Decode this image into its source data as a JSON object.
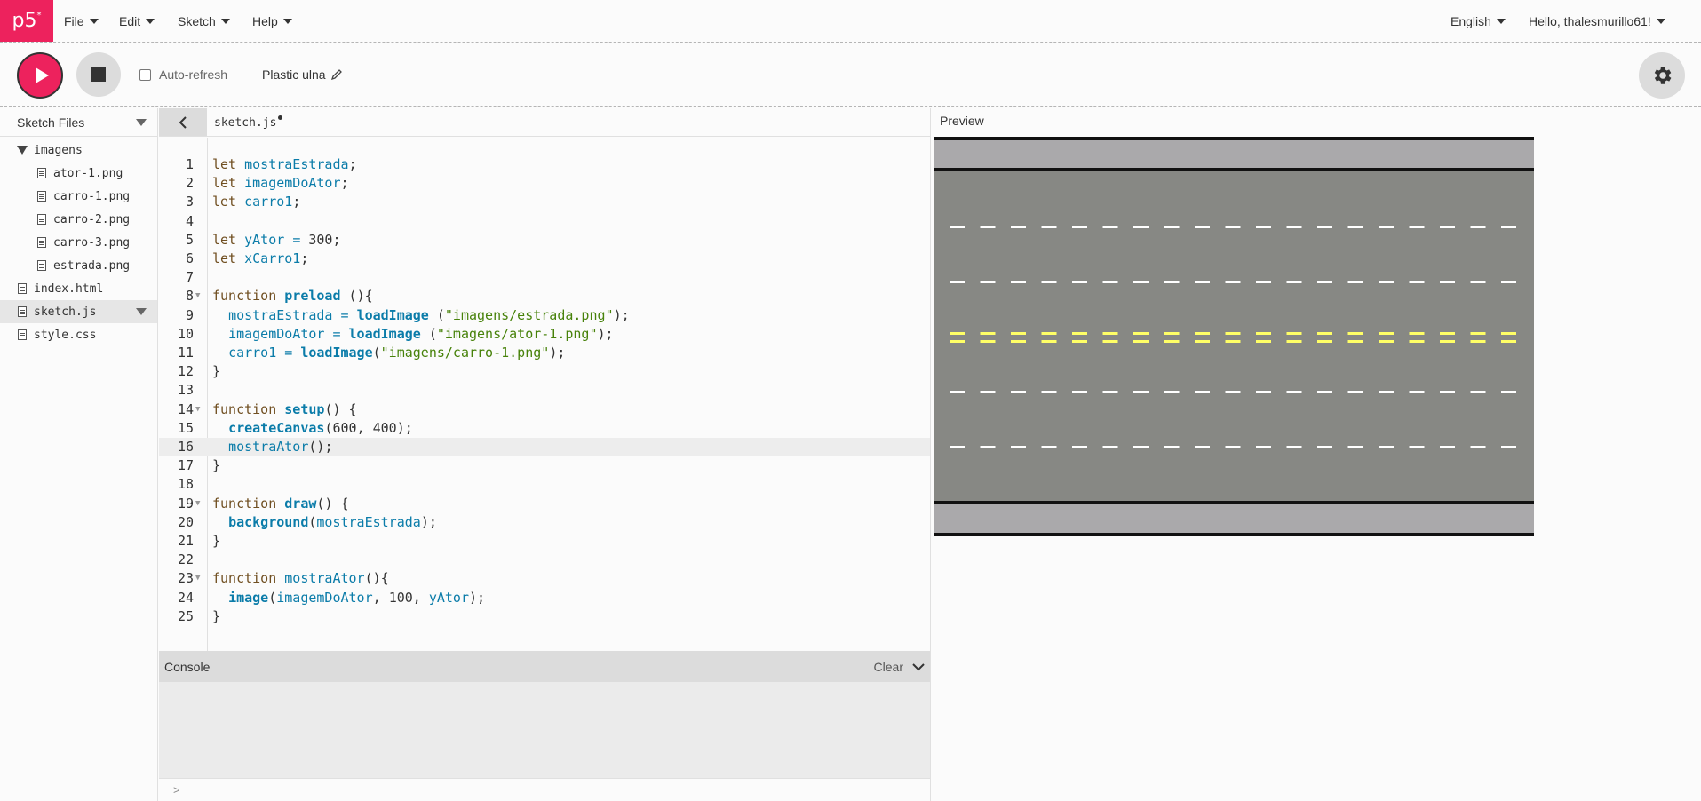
{
  "nav": {
    "logo": "p5",
    "logo_sup": "*",
    "menus": [
      "File",
      "Edit",
      "Sketch",
      "Help"
    ],
    "language": "English",
    "user": "Hello, thalesmurillo61!"
  },
  "toolbar": {
    "auto_refresh_label": "Auto-refresh",
    "auto_refresh_checked": false,
    "sketch_name": "Plastic ulna"
  },
  "sidebar": {
    "title": "Sketch Files",
    "folder": "imagens",
    "folder_files": [
      "ator-1.png",
      "carro-1.png",
      "carro-2.png",
      "carro-3.png",
      "estrada.png"
    ],
    "root_files": [
      "index.html",
      "sketch.js",
      "style.css"
    ],
    "selected": "sketch.js"
  },
  "editor": {
    "tab_name": "sketch.js",
    "unsaved": true,
    "active_line": 16,
    "lines": [
      "let mostraEstrada;",
      "let imagemDoAtor;",
      "let carro1;",
      "",
      "let yAtor = 300;",
      "let xCarro1;",
      "",
      "function preload (){",
      "  mostraEstrada = loadImage (\"imagens/estrada.png\");",
      "  imagemDoAtor = loadImage (\"imagens/ator-1.png\");",
      "  carro1 = loadImage(\"imagens/carro-1.png\");",
      "}",
      "",
      "function setup() {",
      "  createCanvas(600, 400);",
      "  mostraAtor();",
      "}",
      "",
      "function draw() {",
      "  background(mostraEstrada);",
      "}",
      "",
      "function mostraAtor(){",
      "  image(imagemDoAtor, 100, yAtor);",
      "}"
    ],
    "fold_lines": [
      8,
      14,
      19,
      23
    ]
  },
  "console": {
    "title": "Console",
    "clear_label": "Clear",
    "prompt": ">"
  },
  "preview": {
    "title": "Preview"
  },
  "colors": {
    "accent": "#ed225d",
    "road": "#878884",
    "sidewalk": "#aaa9ab",
    "lane_white": "#ffffff",
    "lane_yellow": "#ffff66"
  }
}
